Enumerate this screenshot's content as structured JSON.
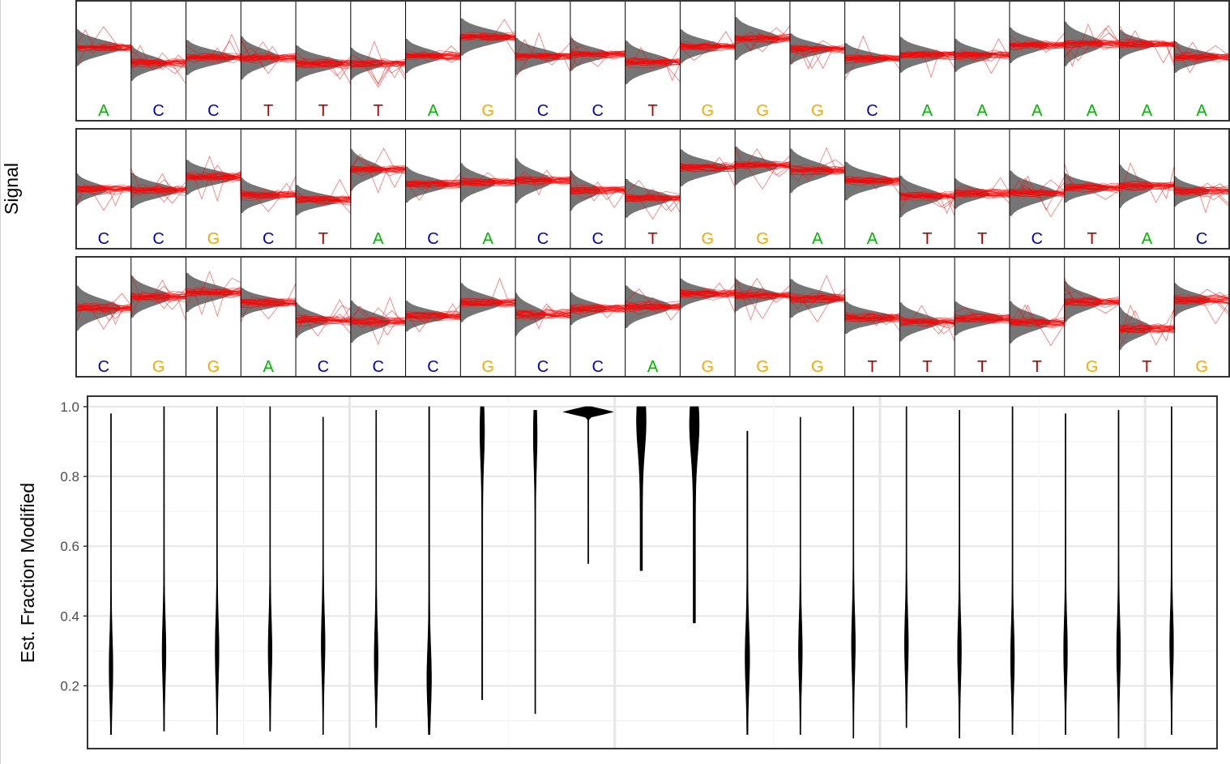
{
  "chart_data": [
    {
      "type": "line",
      "ylabel": "Signal",
      "description_rows": 3,
      "rows": [
        {
          "bases": [
            "A",
            "C",
            "C",
            "T",
            "T",
            "T",
            "A",
            "G",
            "C",
            "C",
            "T",
            "G",
            "G",
            "G",
            "C",
            "A",
            "A",
            "A",
            "A",
            "A",
            "A"
          ]
        },
        {
          "bases": [
            "C",
            "C",
            "G",
            "C",
            "T",
            "A",
            "C",
            "A",
            "C",
            "C",
            "T",
            "G",
            "G",
            "A",
            "A",
            "T",
            "T",
            "C",
            "T",
            "A",
            "C"
          ]
        },
        {
          "bases": [
            "C",
            "G",
            "G",
            "A",
            "C",
            "C",
            "C",
            "G",
            "C",
            "C",
            "A",
            "G",
            "G",
            "G",
            "T",
            "T",
            "T",
            "T",
            "G",
            "T",
            "G"
          ]
        }
      ],
      "base_colors": {
        "A": "#00b800",
        "C": "#0000cc",
        "G": "#ffa500",
        "T": "#b30000"
      },
      "read_trace_color": "#ff0000",
      "reference_density_color": "#6e6e6e"
    },
    {
      "type": "violin",
      "ylabel": "Est. Fraction Modified",
      "yticks": [
        "0.2",
        "0.4",
        "0.6",
        "0.8",
        "1.0"
      ],
      "ylim": [
        0.02,
        1.03
      ],
      "grid": true,
      "violins": [
        {
          "min": 0.06,
          "max": 0.98,
          "center": 0.25,
          "width": 1.0
        },
        {
          "min": 0.07,
          "max": 1.0,
          "center": 0.3,
          "width": 1.0
        },
        {
          "min": 0.06,
          "max": 1.0,
          "center": 0.3,
          "width": 1.0
        },
        {
          "min": 0.07,
          "max": 1.0,
          "center": 0.3,
          "width": 1.0
        },
        {
          "min": 0.06,
          "max": 0.97,
          "center": 0.32,
          "width": 1.0
        },
        {
          "min": 0.08,
          "max": 0.99,
          "center": 0.28,
          "width": 1.0
        },
        {
          "min": 0.06,
          "max": 1.0,
          "center": 0.22,
          "width": 1.2
        },
        {
          "min": 0.16,
          "max": 1.0,
          "center": 0.93,
          "width": 1.2
        },
        {
          "min": 0.12,
          "max": 0.99,
          "center": 0.92,
          "width": 1.0
        },
        {
          "min": 0.55,
          "max": 1.0,
          "center": 0.985,
          "width": 8.0
        },
        {
          "min": 0.53,
          "max": 1.0,
          "center": 0.96,
          "width": 2.5
        },
        {
          "min": 0.38,
          "max": 1.0,
          "center": 0.95,
          "width": 2.5
        },
        {
          "min": 0.06,
          "max": 0.93,
          "center": 0.28,
          "width": 1.2
        },
        {
          "min": 0.06,
          "max": 0.97,
          "center": 0.3,
          "width": 1.0
        },
        {
          "min": 0.05,
          "max": 1.0,
          "center": 0.32,
          "width": 1.0
        },
        {
          "min": 0.08,
          "max": 1.0,
          "center": 0.32,
          "width": 1.0
        },
        {
          "min": 0.05,
          "max": 0.99,
          "center": 0.3,
          "width": 1.0
        },
        {
          "min": 0.06,
          "max": 1.0,
          "center": 0.28,
          "width": 1.0
        },
        {
          "min": 0.06,
          "max": 0.98,
          "center": 0.3,
          "width": 1.0
        },
        {
          "min": 0.05,
          "max": 0.99,
          "center": 0.3,
          "width": 1.0
        },
        {
          "min": 0.06,
          "max": 1.0,
          "center": 0.32,
          "width": 1.0
        }
      ]
    }
  ]
}
